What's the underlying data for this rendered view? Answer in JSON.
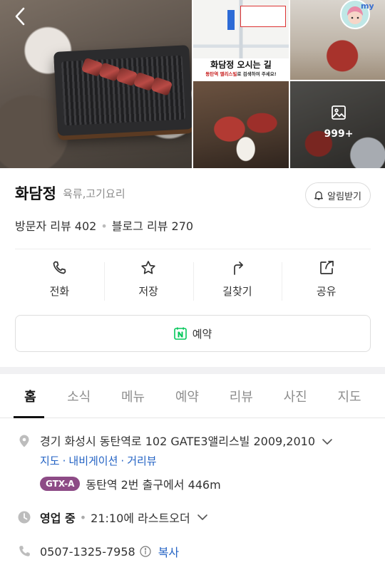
{
  "gallery": {
    "sign_title": "화담정 오시는 길",
    "sign_subtitle_a": "동탄역 앨리스빌",
    "sign_subtitle_b": "로 검색하여 주세요!",
    "more_count": "999+"
  },
  "place": {
    "name": "화담정",
    "category": "육류,고기요리",
    "alarm_label": "알림받기",
    "visitor_reviews": "방문자 리뷰 402",
    "blog_reviews": "블로그 리뷰 270"
  },
  "actions": [
    {
      "label": "전화",
      "icon": "phone-icon"
    },
    {
      "label": "저장",
      "icon": "star-icon"
    },
    {
      "label": "길찾기",
      "icon": "directions-icon"
    },
    {
      "label": "공유",
      "icon": "share-icon"
    }
  ],
  "reserve_label": "예약",
  "tabs": [
    "홈",
    "소식",
    "메뉴",
    "예약",
    "리뷰",
    "사진",
    "지도"
  ],
  "active_tab": "홈",
  "details": {
    "address": "경기 화성시 동탄역로 102 GATE3앨리스빌 2009,2010",
    "links": [
      "지도",
      "내비게이션",
      "거리뷰"
    ],
    "subway_line": "GTX-A",
    "subway_text": "동탄역 2번 출구에서 446m",
    "hours_status": "영업 중",
    "hours_text": "21:10에 라스트오더",
    "phone": "0507-1325-7958",
    "copy_label": "복사"
  },
  "colors": {
    "link_blue": "#2463c4",
    "gtx_purple": "#8d4b86",
    "naver_green": "#03c75a"
  }
}
